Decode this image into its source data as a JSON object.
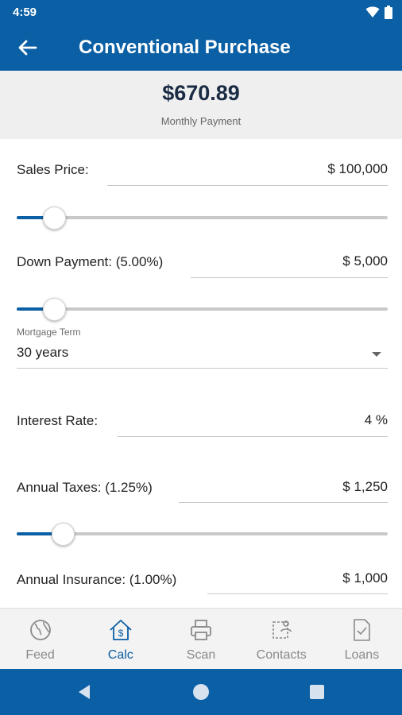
{
  "status_bar": {
    "time": "4:59"
  },
  "app_bar": {
    "title": "Conventional Purchase"
  },
  "summary": {
    "amount": "$670.89",
    "label": "Monthly Payment"
  },
  "fields": {
    "sales_price": {
      "label": "Sales Price:",
      "value": "$ 100,000",
      "slider_fraction": 0.1
    },
    "down_payment": {
      "label": "Down Payment: (5.00%)",
      "value": "$ 5,000",
      "slider_fraction": 0.1
    },
    "mortgage_term": {
      "label": "Mortgage Term",
      "value": "30 years"
    },
    "interest_rate": {
      "label": "Interest Rate:",
      "value": "4 %"
    },
    "annual_taxes": {
      "label": "Annual Taxes: (1.25%)",
      "value": "$ 1,250",
      "slider_fraction": 0.125
    },
    "annual_insurance": {
      "label": "Annual Insurance: (1.00%)",
      "value": "$ 1,000"
    }
  },
  "bottom_nav": {
    "items": [
      {
        "label": "Feed",
        "icon": "globe-icon",
        "active": false
      },
      {
        "label": "Calc",
        "icon": "house-dollar-icon",
        "active": true
      },
      {
        "label": "Scan",
        "icon": "printer-icon",
        "active": false
      },
      {
        "label": "Contacts",
        "icon": "contacts-icon",
        "active": false
      },
      {
        "label": "Loans",
        "icon": "document-check-icon",
        "active": false
      }
    ]
  },
  "colors": {
    "primary": "#0b5fa5",
    "summary_bg": "#efefef",
    "nav_bg": "#f3f3f3",
    "inactive": "#8a8a8a"
  }
}
